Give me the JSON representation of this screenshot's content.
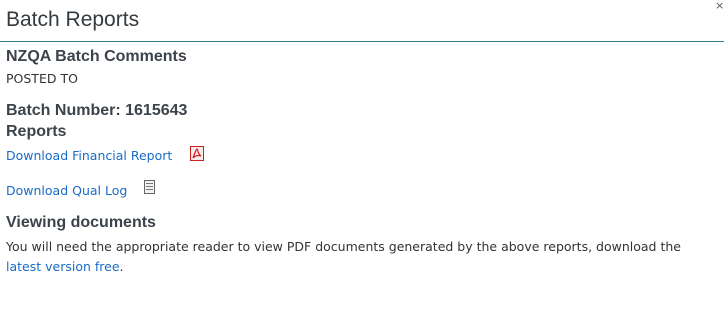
{
  "header": {
    "title": "Batch Reports",
    "close_glyph": "×"
  },
  "batch_comments": {
    "heading": "NZQA Batch Comments",
    "posted_to": "POSTED TO"
  },
  "batch": {
    "number_label": "Batch Number: 1615643"
  },
  "reports": {
    "heading": "Reports",
    "financial_link": "Download Financial Report",
    "financial_icon": "pdf-icon",
    "qual_link": "Download Qual Log",
    "qual_icon": "document-icon"
  },
  "viewing": {
    "heading": "Viewing documents",
    "text": "You will need the appropriate reader to view PDF documents generated by the above reports, download the",
    "link": "latest version free",
    "suffix": "."
  },
  "colors": {
    "link": "#1a6bc7",
    "header_rule": "#3a7e96",
    "pdf_red": "#cc1f1f"
  }
}
